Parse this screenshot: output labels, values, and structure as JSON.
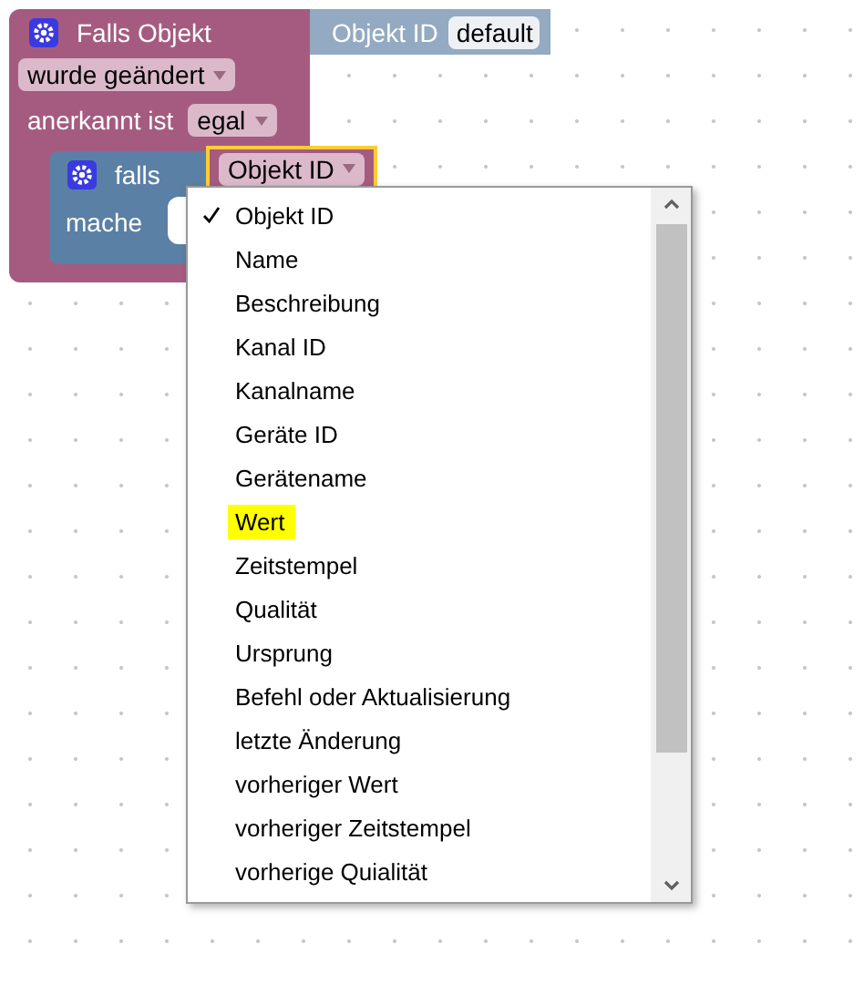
{
  "trigger_block": {
    "title": "Falls Objekt",
    "change_dropdown": "wurde geändert",
    "ack_label": "anerkannt ist",
    "ack_dropdown": "egal"
  },
  "object_block": {
    "label": "Objekt ID",
    "value": "default"
  },
  "if_block": {
    "if_label": "falls",
    "do_label": "mache",
    "attribute_dropdown": "Objekt ID"
  },
  "menu": {
    "items": [
      {
        "label": "Objekt ID",
        "checked": true,
        "highlighted": false
      },
      {
        "label": "Name",
        "checked": false,
        "highlighted": false
      },
      {
        "label": "Beschreibung",
        "checked": false,
        "highlighted": false
      },
      {
        "label": "Kanal ID",
        "checked": false,
        "highlighted": false
      },
      {
        "label": "Kanalname",
        "checked": false,
        "highlighted": false
      },
      {
        "label": "Geräte ID",
        "checked": false,
        "highlighted": false
      },
      {
        "label": "Gerätename",
        "checked": false,
        "highlighted": false
      },
      {
        "label": "Wert",
        "checked": false,
        "highlighted": true
      },
      {
        "label": "Zeitstempel",
        "checked": false,
        "highlighted": false
      },
      {
        "label": "Qualität",
        "checked": false,
        "highlighted": false
      },
      {
        "label": "Ursprung",
        "checked": false,
        "highlighted": false
      },
      {
        "label": "Befehl oder Aktualisierung",
        "checked": false,
        "highlighted": false
      },
      {
        "label": "letzte Änderung",
        "checked": false,
        "highlighted": false
      },
      {
        "label": "vorheriger Wert",
        "checked": false,
        "highlighted": false
      },
      {
        "label": "vorheriger Zeitstempel",
        "checked": false,
        "highlighted": false
      },
      {
        "label": "vorherige Quialität",
        "checked": false,
        "highlighted": false
      }
    ]
  }
}
